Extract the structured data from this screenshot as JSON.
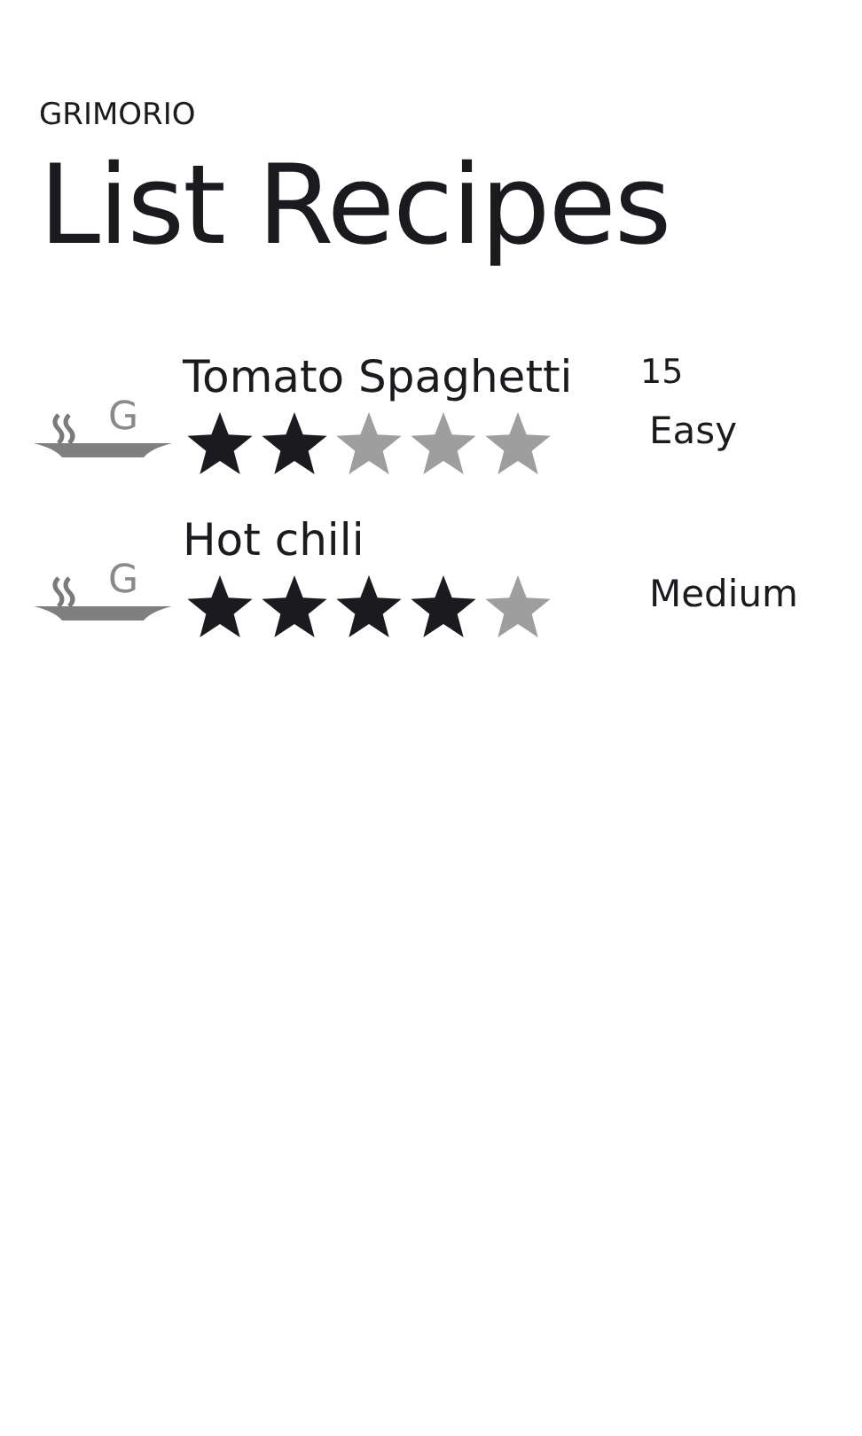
{
  "app_title": "GRIMORIO",
  "page_title": "List Recipes",
  "recipes": [
    {
      "name": "Tomato Spaghetti",
      "logo_letter": "G",
      "stars": 2,
      "time": "15",
      "difficulty": "Easy"
    },
    {
      "name": "Hot chili",
      "logo_letter": "G",
      "stars": 4,
      "difficulty": "Medium"
    }
  ]
}
